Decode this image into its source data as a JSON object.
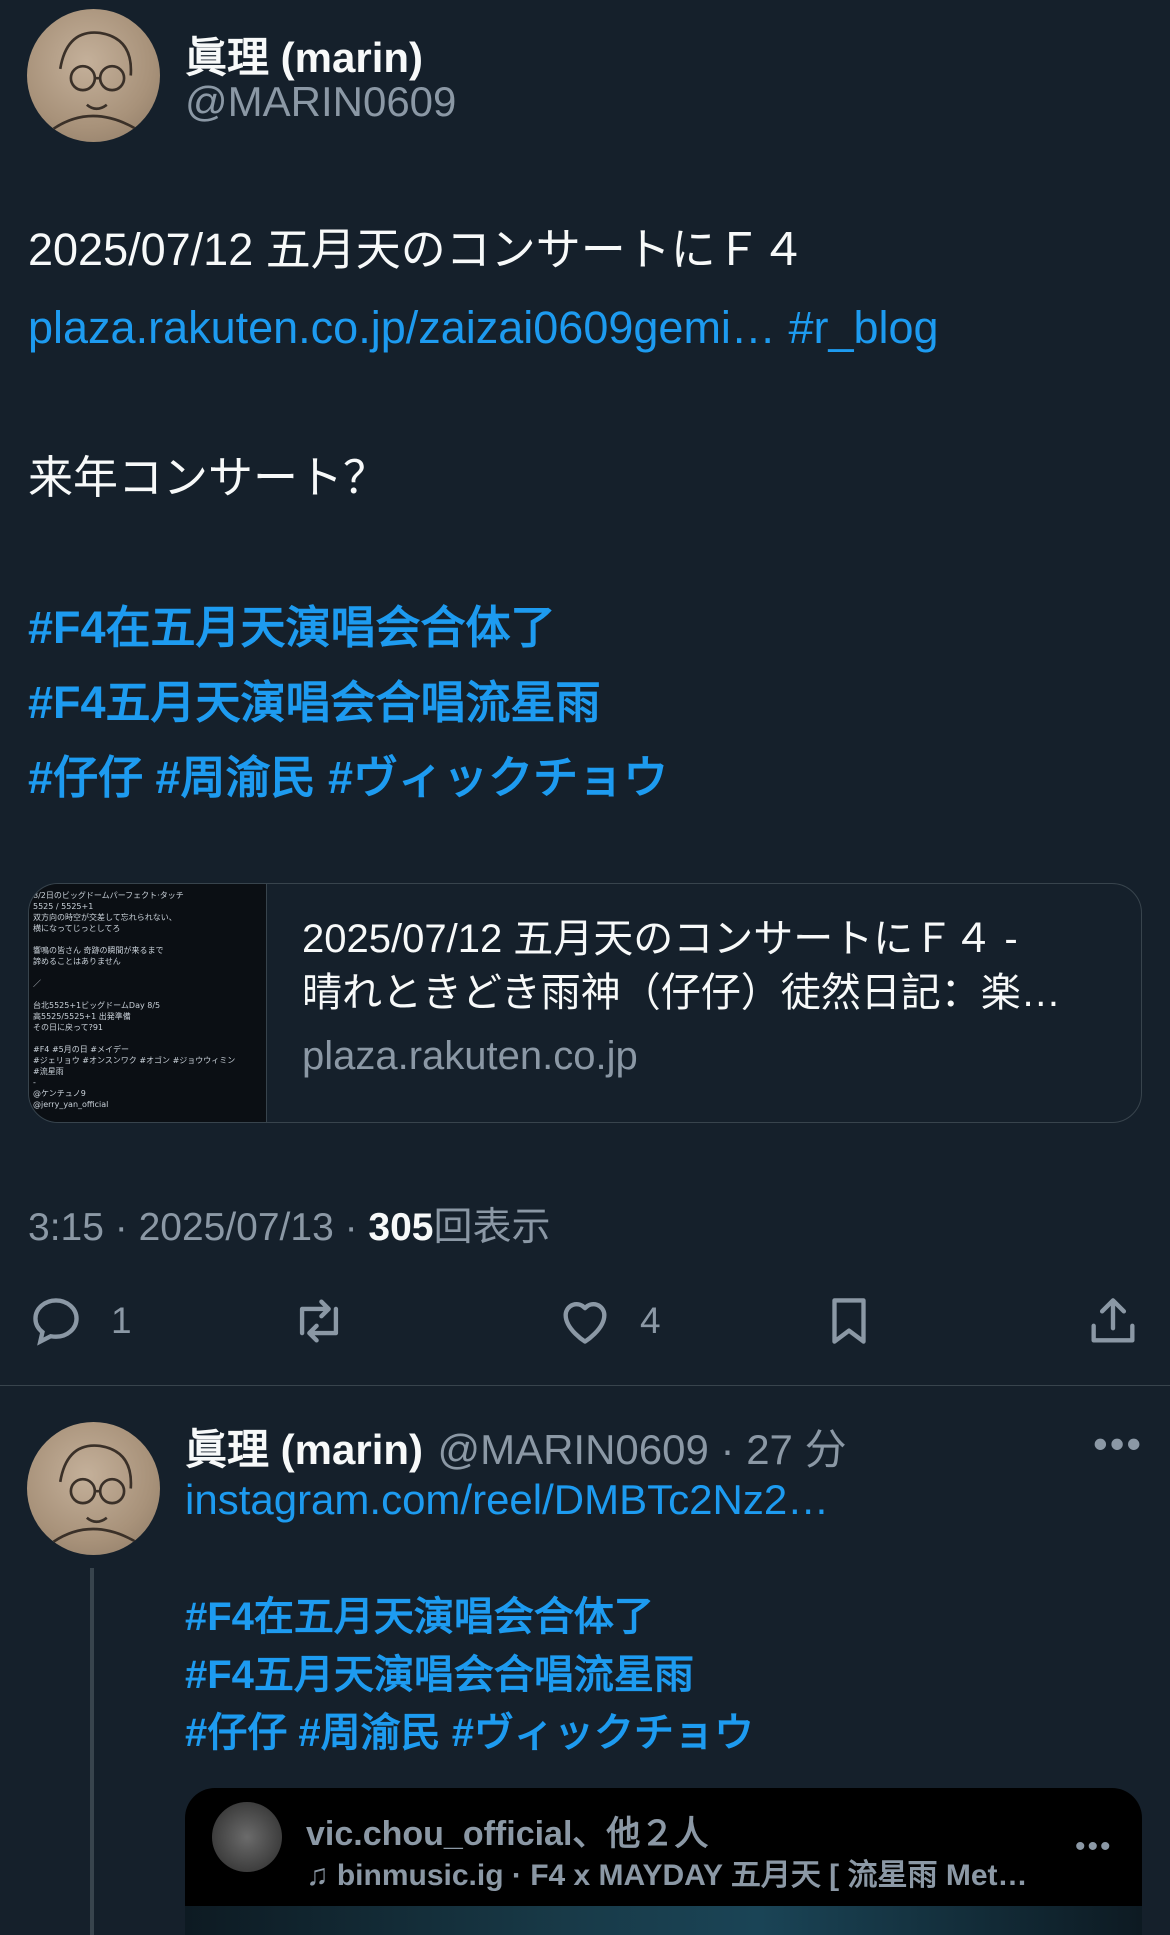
{
  "post": {
    "display_name": "眞理 (marin)",
    "handle": "@MARIN0609",
    "text_line1": "2025/07/12  五月天のコンサートにＦ４",
    "link_text": "plaza.rakuten.co.jp/zaizai0609gemi…",
    "link_tag": "#r_blog",
    "text_line2": "来年コンサート？",
    "hashtags": [
      "#F4在五月天演唱会合体了",
      "#F4五月天演唱会合唱流星雨",
      "#仔仔 #周渝民 #ヴィックチョウ"
    ],
    "card": {
      "title_line1": "2025/07/12 五月天のコンサートにＦ４ -",
      "title_line2": "晴れときどき雨神（仔仔）徒然日記：楽…",
      "domain": "plaza.rakuten.co.jp",
      "thumb_lines": [
        "8/2日のビッグドームパーフェクト·タッチ",
        "5525 / 5525+1",
        "双方向の時空が交差して忘れられない、",
        "横になってじっとしてろ",
        "",
        "響鳴の皆さん 奇跡の瞬間が来るまで",
        "諦めることはありません",
        "",
        "／",
        "",
        "台北5525+1ビッグドームDay 8/5",
        "高5525/5525+1 出発準備",
        "その日に戻って?91",
        "",
        "#F4 #5月の日 #メイデー",
        "#ジェリョウ #オンスンワク #オゴン #ジョウウィミン",
        "#流星雨",
        "-",
        "@ケンチュノ9",
        "@jerry_yan_official"
      ]
    },
    "meta_time": "3:15 · 2025/07/13 · ",
    "meta_views": "305",
    "meta_views_label": "回表示",
    "actions": {
      "reply_count": "1",
      "retweet_count": "",
      "like_count": "4"
    }
  },
  "reply": {
    "display_name": "眞理 (marin)",
    "handle_time": "@MARIN0609 · 27 分",
    "link_text": "instagram.com/reel/DMBTc2Nz2…",
    "hashtags": [
      "#F4在五月天演唱会合体了",
      "#F4五月天演唱会合唱流星雨",
      "#仔仔 #周渝民 #ヴィックチョウ"
    ],
    "embed": {
      "account": "vic.chou_official、他２人",
      "music_line": "binmusic.ig · F4 x MAYDAY 五月天 [ 流星雨 Met…"
    }
  },
  "colors": {
    "background": "#15202b",
    "accent": "#1d9bf0",
    "muted": "#8b98a5"
  }
}
